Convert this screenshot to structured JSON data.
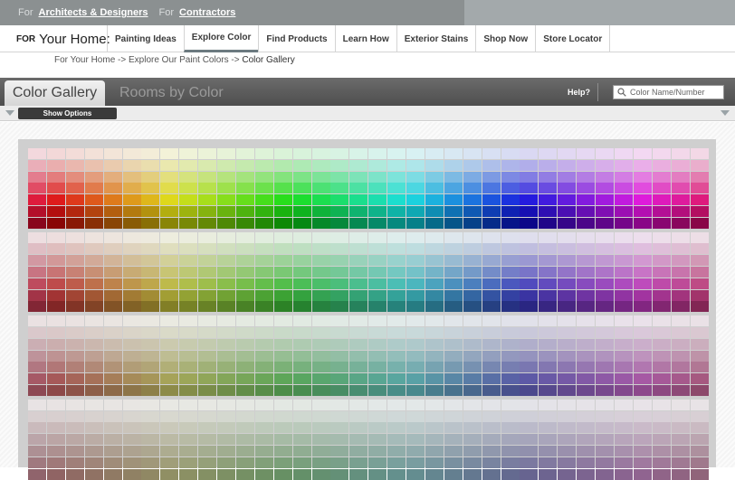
{
  "audience_bar": {
    "for_label_1": "For",
    "link_1": "Architects & Designers",
    "for_label_2": "For",
    "link_2": "Contractors"
  },
  "main_nav": {
    "brand_small": "FOR",
    "brand_big": "Your Home:",
    "items": [
      {
        "label": "Painting Ideas"
      },
      {
        "label": "Explore Color",
        "active": true
      },
      {
        "label": "Find Products"
      },
      {
        "label": "Learn How"
      },
      {
        "label": "Exterior Stains"
      },
      {
        "label": "Shop Now"
      },
      {
        "label": "Store Locator"
      }
    ]
  },
  "breadcrumb": {
    "crumb_1": "For Your Home",
    "sep": "->",
    "crumb_2": "Explore Our Paint Colors",
    "crumb_3": "Color Gallery"
  },
  "gallery_header": {
    "tab_active": "Color Gallery",
    "tab_inactive": "Rooms by Color",
    "help": "Help?",
    "search_placeholder": "Color Name/Number"
  },
  "options_bar": {
    "show_options": "Show Options"
  },
  "palette": {
    "columns": 36,
    "rows_per_band": 7,
    "bands": 4,
    "accent_colors": {
      "page_bg": "#ffffff",
      "top_bar": "#8b9091",
      "header_dark": "#555555",
      "frame": "#cfcfcf"
    }
  }
}
